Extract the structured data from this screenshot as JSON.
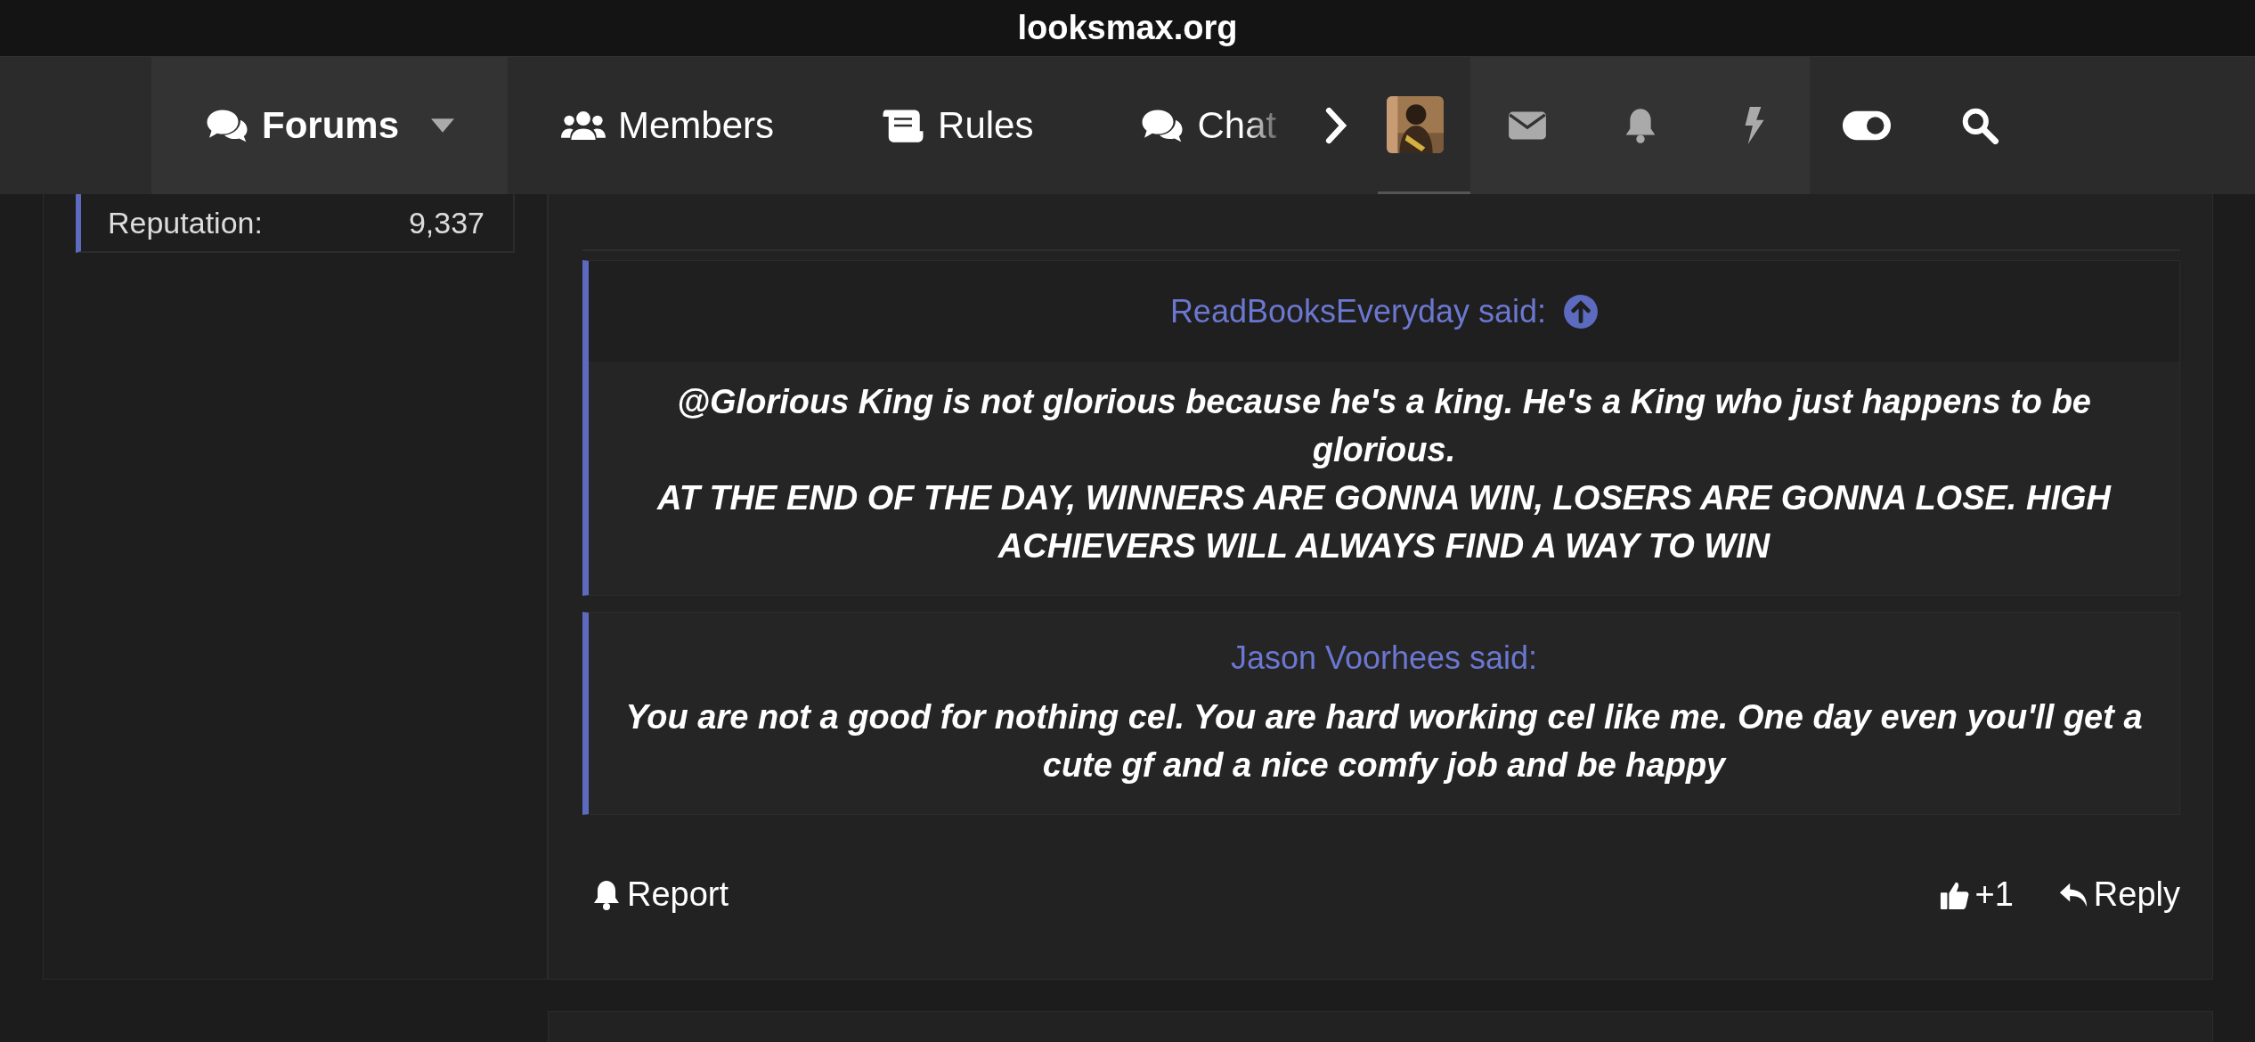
{
  "browser_bar": {
    "title": "looksmax.org"
  },
  "nav": {
    "tabs": [
      {
        "label": "Forums",
        "selected": true,
        "dropdown": true
      },
      {
        "label": "Members",
        "selected": false,
        "dropdown": false
      },
      {
        "label": "Rules",
        "selected": false,
        "dropdown": false
      },
      {
        "label": "Chat",
        "selected": false,
        "dropdown": false
      }
    ],
    "tools": [
      {
        "kind": "mail",
        "selected": true
      },
      {
        "kind": "bell",
        "selected": true
      },
      {
        "kind": "bolt",
        "selected": true
      },
      {
        "kind": "toggle",
        "selected": false
      },
      {
        "kind": "search",
        "selected": false
      }
    ]
  },
  "user_info": {
    "label": "Reputation:",
    "value": "9,337"
  },
  "quotes": [
    {
      "author": "ReadBooksEveryday said:",
      "has_jump": true,
      "paragraphs": [
        "@Glorious King is not glorious because he's a king. He's a King who just happens to be glorious.",
        "AT THE END OF THE DAY, WINNERS ARE GONNA WIN, LOSERS ARE GONNA LOSE. HIGH ACHIEVERS WILL ALWAYS FIND A WAY TO WIN"
      ]
    },
    {
      "author": "Jason Voorhees said:",
      "has_jump": false,
      "paragraphs": [
        "You are not a good for nothing cel. You are hard working cel like me. One day even you'll get a cute gf and a nice comfy job and be happy"
      ]
    }
  ],
  "actions": {
    "report": "Report",
    "likes": "+1",
    "reply": "Reply"
  }
}
